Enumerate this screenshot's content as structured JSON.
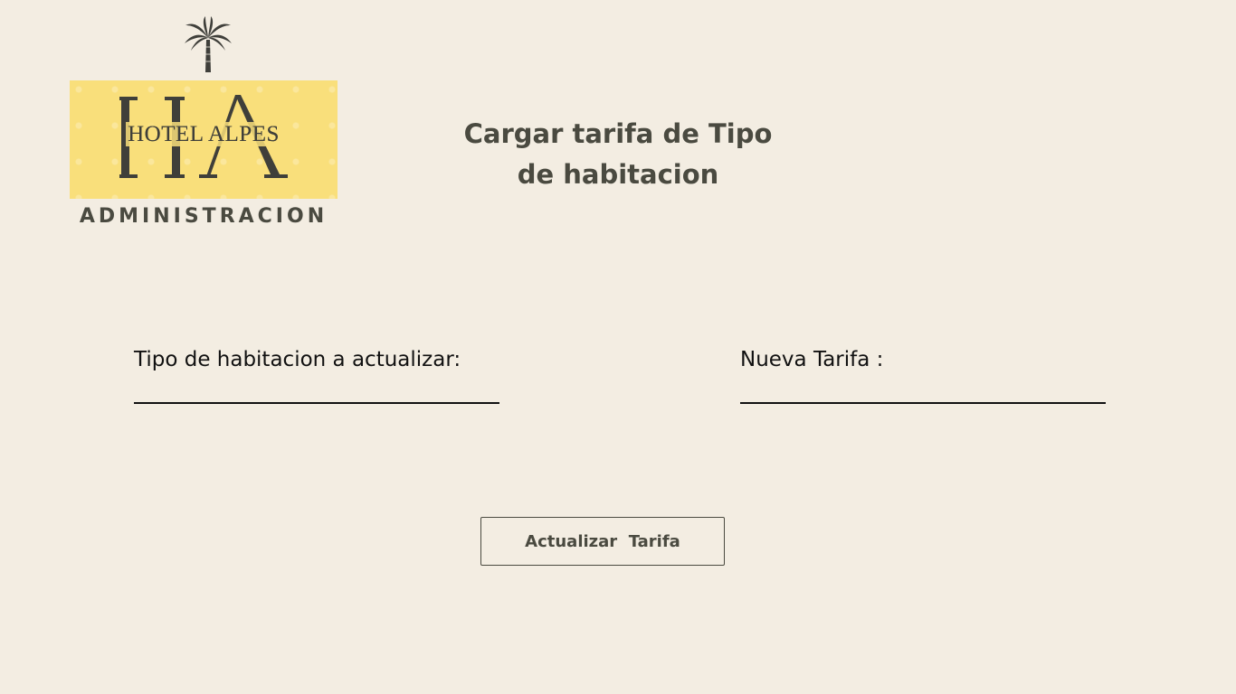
{
  "logo": {
    "brand": "HOTEL ALPES",
    "monogram": "HA",
    "subtitle": "ADMINISTRACION",
    "icon": "palm-tree-icon",
    "colors": {
      "box": "#f9df7b",
      "ink": "#3f3f3a"
    }
  },
  "page": {
    "title_line1": "Cargar tarifa de Tipo",
    "title_line2": "de habitacion"
  },
  "form": {
    "room_type": {
      "label": "Tipo de habitacion a actualizar:",
      "value": ""
    },
    "new_rate": {
      "label": "Nueva Tarifa :",
      "value": ""
    },
    "submit_label": "Actualizar  Tarifa"
  },
  "colors": {
    "background": "#f3ede2",
    "text": "#4a4a40",
    "label": "#111111"
  }
}
